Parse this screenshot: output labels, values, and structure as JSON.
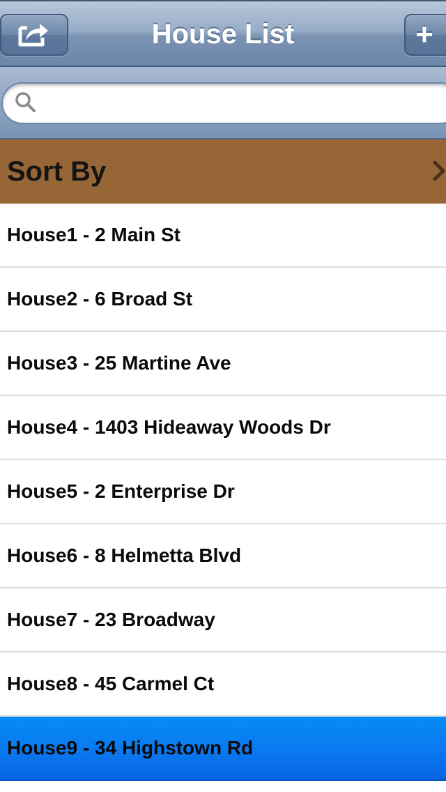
{
  "navbar": {
    "title": "House List",
    "share_icon": "share-icon",
    "add_label": "+"
  },
  "search": {
    "placeholder": "",
    "value": "",
    "icon": "search-icon"
  },
  "sort": {
    "label": "Sort By",
    "icon": "chevron-right-icon",
    "background": "#976636"
  },
  "houses": [
    {
      "label": "House1 - 2 Main St",
      "selected": false
    },
    {
      "label": "House2 - 6 Broad St",
      "selected": false
    },
    {
      "label": "House3 - 25 Martine Ave",
      "selected": false
    },
    {
      "label": "House4 - 1403 Hideaway Woods Dr",
      "selected": false
    },
    {
      "label": "House5 - 2 Enterprise Dr",
      "selected": false
    },
    {
      "label": "House6 - 8 Helmetta Blvd",
      "selected": false
    },
    {
      "label": "House7 - 23 Broadway",
      "selected": false
    },
    {
      "label": "House8 - 45 Carmel Ct",
      "selected": false
    },
    {
      "label": "House9 - 34 Highstown Rd",
      "selected": true
    }
  ],
  "colors": {
    "navbar": "#7b93b3",
    "selection": "#0a7af0"
  }
}
